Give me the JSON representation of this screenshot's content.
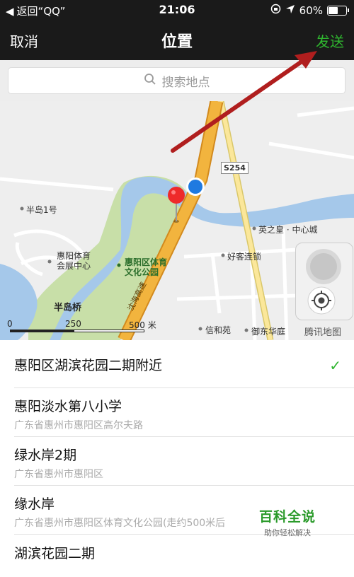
{
  "status_bar": {
    "back_label": "返回“QQ”",
    "time": "21:06",
    "battery": "60%",
    "battery_level": 0.6
  },
  "nav": {
    "cancel": "取消",
    "title": "位置",
    "send": "发送"
  },
  "search": {
    "placeholder": "搜索地点"
  },
  "map": {
    "road_tag": "S254",
    "labels": {
      "banbao": "半岛1号",
      "tiyu_center": "惠阳体育\n会展中心",
      "park": "惠阳区体育\n文化公园",
      "yingzhihuang": "英之皇 · 中心城",
      "haoke": "好客连锁",
      "bandao_bridge": "半岛桥",
      "xinhe": "信和苑",
      "yudong": "御东华庭",
      "road_name": "沈海高速"
    },
    "scale": {
      "start": "0",
      "mid": "250",
      "end": "500 米"
    },
    "brand": "腾讯地图",
    "colors": {
      "water": "#a5c8ea",
      "park": "#c8dfa8",
      "highway": "#f2b43e",
      "marker": "#ee2a2a",
      "location_dot": "#1f7ae0",
      "annotation_arrow": "#b01e1e"
    }
  },
  "results": [
    {
      "name": "惠阳区湖滨花园二期附近",
      "address": "",
      "selected": true
    },
    {
      "name": "惠阳淡水第八小学",
      "address": "广东省惠州市惠阳区高尔夫路",
      "selected": false
    },
    {
      "name": "绿水岸2期",
      "address": "广东省惠州市惠阳区",
      "selected": false
    },
    {
      "name": "缘水岸",
      "address": "广东省惠州市惠阳区体育文化公园(走约500米后",
      "selected": false
    },
    {
      "name": "湖滨花园二期",
      "address": "",
      "selected": false
    }
  ],
  "watermark": {
    "title": "百科全说",
    "subtitle": "助你轻松解决"
  }
}
